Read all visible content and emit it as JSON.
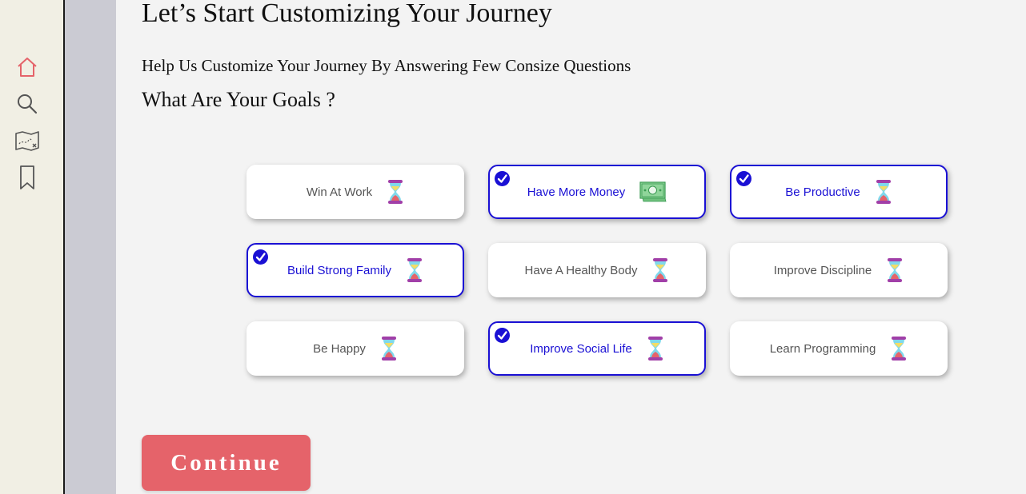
{
  "sidebar": {
    "items": [
      {
        "icon": "home-icon",
        "active": true
      },
      {
        "icon": "search-icon",
        "active": false
      },
      {
        "icon": "map-icon",
        "active": false
      },
      {
        "icon": "bookmark-icon",
        "active": false
      }
    ]
  },
  "page": {
    "title": "Let’s Start Customizing Your Journey",
    "subtitle": "Help Us Customize Your Journey By Answering Few Consize Questions",
    "question": "What Are Your Goals ?"
  },
  "goals": [
    {
      "label": "Win At Work",
      "icon": "hourglass-icon",
      "selected": false
    },
    {
      "label": "Have More Money",
      "icon": "money-icon",
      "selected": true
    },
    {
      "label": "Be Productive",
      "icon": "hourglass-icon",
      "selected": true
    },
    {
      "label": "Build Strong Family",
      "icon": "hourglass-icon",
      "selected": true
    },
    {
      "label": "Have A Healthy Body",
      "icon": "hourglass-icon",
      "selected": false
    },
    {
      "label": "Improve Discipline",
      "icon": "hourglass-icon",
      "selected": false
    },
    {
      "label": "Be Happy",
      "icon": "hourglass-icon",
      "selected": false
    },
    {
      "label": "Improve Social Life",
      "icon": "hourglass-icon",
      "selected": true
    },
    {
      "label": "Learn Programming",
      "icon": "hourglass-icon",
      "selected": false
    }
  ],
  "actions": {
    "continue_label": "Continue"
  },
  "colors": {
    "accent": "#1a10d4",
    "button": "#e5636a",
    "active_nav": "#e5636a"
  }
}
